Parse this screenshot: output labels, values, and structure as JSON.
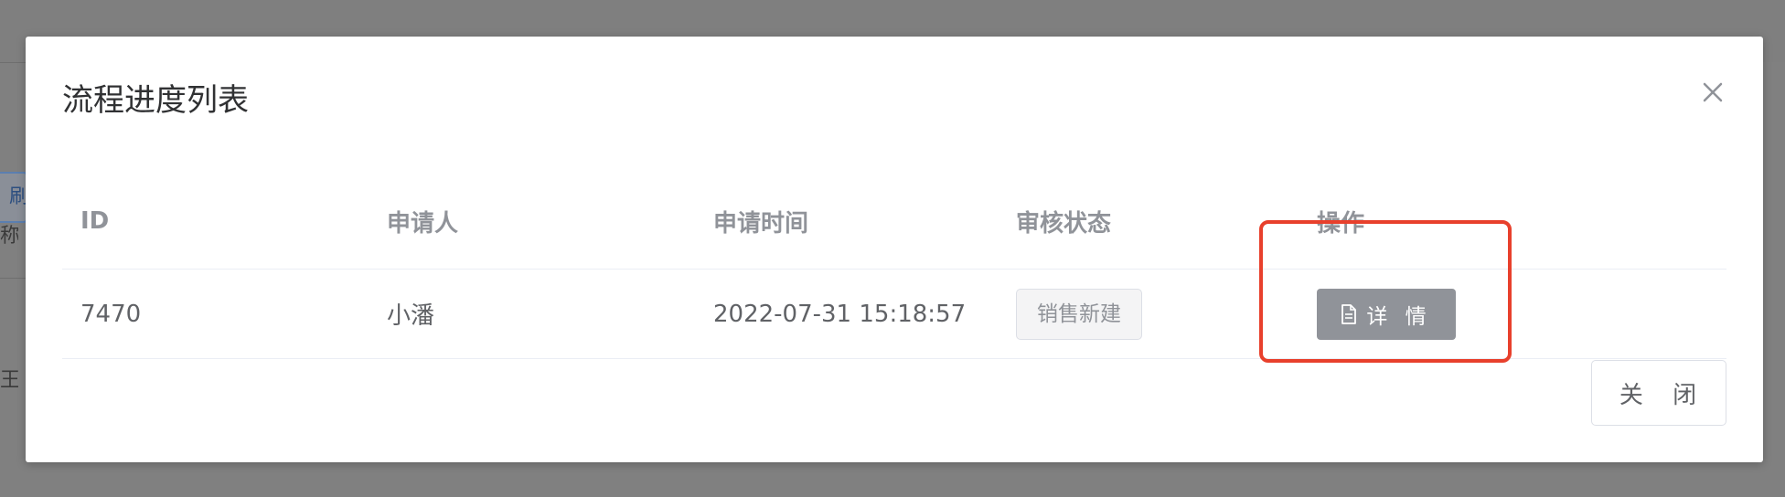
{
  "background": {
    "side_button_label": "刷",
    "side_text_1": "称",
    "side_text_2": "王"
  },
  "modal": {
    "title": "流程进度列表",
    "close_icon": "close-icon",
    "table": {
      "headers": [
        "ID",
        "申请人",
        "申请时间",
        "审核状态",
        "操作"
      ],
      "rows": [
        {
          "id": "7470",
          "applicant": "小潘",
          "apply_time": "2022-07-31 15:18:57",
          "status": "销售新建",
          "action_label": "详 情",
          "action_icon": "document-icon"
        }
      ]
    },
    "footer": {
      "close_label": "关 闭"
    }
  },
  "colors": {
    "highlight": "#e8402c",
    "info_button": "#909399",
    "overlay": "#7f7f7f"
  }
}
